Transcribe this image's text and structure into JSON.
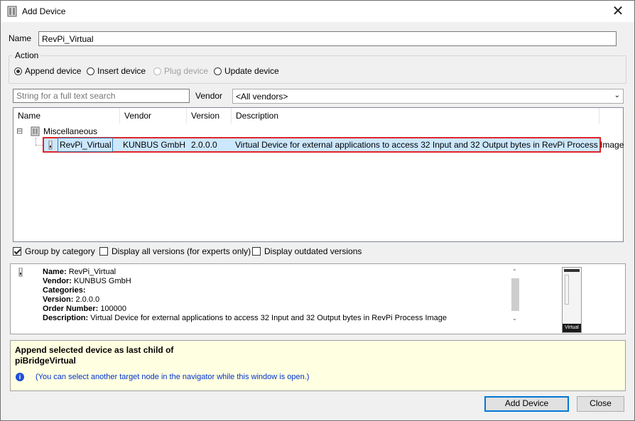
{
  "window": {
    "title": "Add Device",
    "close_glyph": "✕"
  },
  "name_field": {
    "label": "Name",
    "value": "RevPi_Virtual"
  },
  "action": {
    "legend": "Action",
    "options": [
      {
        "label": "Append device",
        "checked": true,
        "enabled": true
      },
      {
        "label": "Insert device",
        "checked": false,
        "enabled": true
      },
      {
        "label": "Plug device",
        "checked": false,
        "enabled": false
      },
      {
        "label": "Update device",
        "checked": false,
        "enabled": true
      }
    ]
  },
  "search": {
    "placeholder": "String for a full text search"
  },
  "vendor_filter": {
    "label": "Vendor",
    "selected": "<All vendors>"
  },
  "device_list": {
    "columns": [
      "Name",
      "Vendor",
      "Version",
      "Description"
    ],
    "groups": [
      {
        "expander": "⊟",
        "name": "Miscellaneous",
        "items": [
          {
            "name": "RevPi_Virtual",
            "vendor": "KUNBUS GmbH",
            "version": "2.0.0.0",
            "description": "Virtual Device for external applications to access 32 Input and 32 Output bytes in RevPi Process Image"
          }
        ]
      }
    ]
  },
  "options": {
    "group_by_category": {
      "label": "Group by category",
      "checked": true
    },
    "display_all_versions": {
      "label": "Display all versions (for experts only)",
      "checked": false
    },
    "display_outdated": {
      "label": "Display outdated versions",
      "checked": false
    }
  },
  "details": {
    "name_label": "Name:",
    "name_value": "RevPi_Virtual",
    "vendor_label": "Vendor:",
    "vendor_value": "KUNBUS GmbH",
    "categories_label": "Categories:",
    "categories_value": "",
    "version_label": "Version:",
    "version_value": "2.0.0.0",
    "order_label": "Order Number:",
    "order_value": "100000",
    "description_label": "Description:",
    "description_value": "Virtual Device for external applications to access 32 Input and 32 Output bytes in RevPi Process Image",
    "image_caption": "Virtual"
  },
  "hint": {
    "line1": "Append selected device as last child of",
    "line2": "piBridgeVirtual",
    "info_glyph": "i",
    "info_text": "(You can select another target node in the navigator while this window is open.)"
  },
  "buttons": {
    "add": "Add Device",
    "close": "Close"
  },
  "colors": {
    "selection": "#cce8ff",
    "highlight_box": "#e0232b",
    "hint_bg": "#ffffe1",
    "info_blue": "#0033cc",
    "default_button": "#0078d7"
  }
}
